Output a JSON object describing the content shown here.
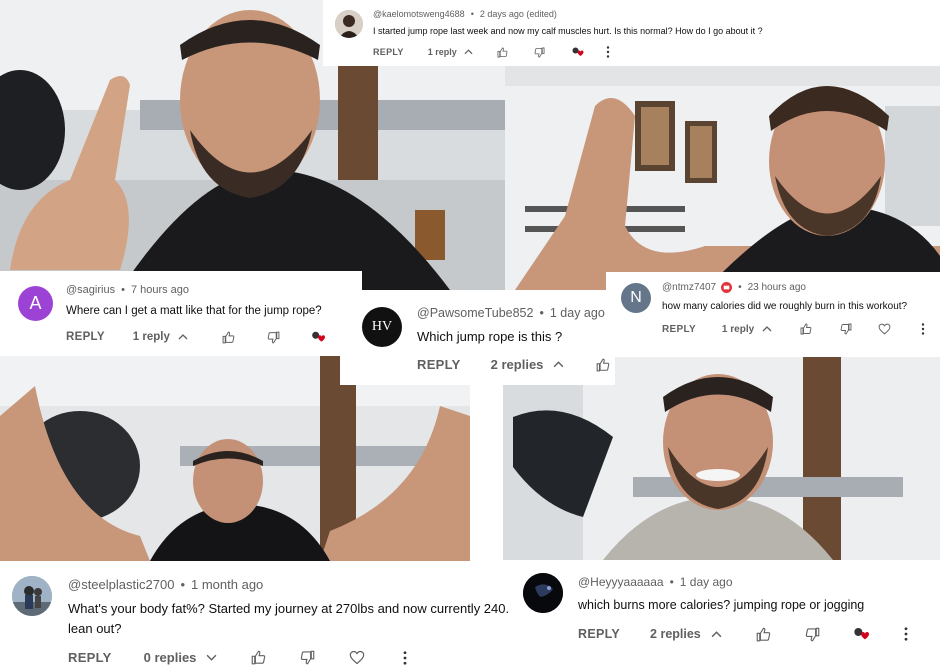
{
  "colors": {
    "text": "#0f0f0f",
    "meta": "#606060",
    "heart": "#d0021b",
    "avatar_a": "#9c43d6",
    "avatar_n": "#65768a"
  },
  "comments": [
    {
      "author": "@kaelomotsweng4688",
      "time": "2 days ago (edited)",
      "text": "I started jump rope last week and now my calf muscles hurt. Is this normal? How do I go about it ?",
      "reply_label": "REPLY",
      "replies_label": "1 reply",
      "avatar": "photo-avatar"
    },
    {
      "author": "@sagirius",
      "time": "7 hours ago",
      "text": "Where can I get a matt like that for the jump rope?",
      "reply_label": "REPLY",
      "replies_label": "1 reply",
      "avatar_letter": "A"
    },
    {
      "author": "@PawsomeTube852",
      "time": "1 day ago",
      "text": "Which jump rope is this ?",
      "reply_label": "REPLY",
      "replies_label": "2 replies",
      "avatar_letter": "HV"
    },
    {
      "author": "@ntmz7407",
      "time": "23 hours ago",
      "text": "how many calories did we roughly burn in this workout?",
      "reply_label": "REPLY",
      "replies_label": "1 reply",
      "avatar_letter": "N"
    },
    {
      "author": "@steelplastic2700",
      "time": "1 month ago",
      "text_line1": "What's your body fat%? Started my journey at 270lbs and now currently 240.",
      "text_line2": "lean out?",
      "reply_label": "REPLY",
      "replies_label": "0 replies",
      "avatar": "photo-avatar"
    },
    {
      "author": "@Heyyyaaaaaa",
      "time": "1 day ago",
      "text": "which burns more calories? jumping rope or jogging",
      "reply_label": "REPLY",
      "replies_label": "2 replies",
      "avatar": "photo-avatar"
    }
  ],
  "icons": {
    "like": "thumbs-up-icon",
    "dislike": "thumbs-down-icon",
    "creator_heart": "creator-heart-icon",
    "heart": "heart-outline-icon",
    "more": "more-vert-icon",
    "expand": "chevron-up-icon",
    "collapse": "chevron-down-icon"
  }
}
